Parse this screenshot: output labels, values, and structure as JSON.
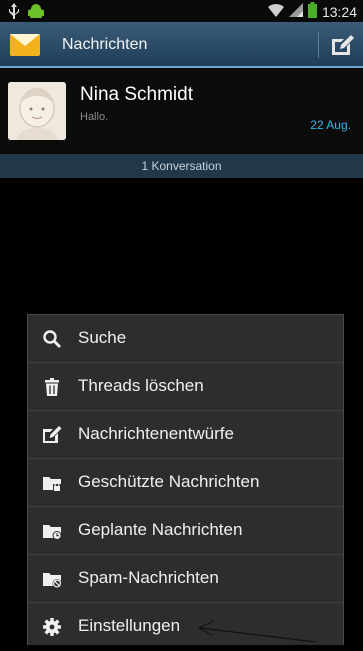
{
  "status_bar": {
    "time": "13:24",
    "icons": [
      "usb-icon",
      "android-icon",
      "wifi-icon",
      "signal-icon",
      "battery-icon"
    ],
    "battery_color": "#4caf2a"
  },
  "action_bar": {
    "title": "Nachrichten",
    "icon": "messages-app-icon",
    "compose_icon": "compose-icon"
  },
  "conversation": {
    "name": "Nina Schmidt",
    "preview": "Hallo.",
    "date": "22 Aug."
  },
  "section": {
    "label": "1 Konversation"
  },
  "menu": {
    "items": [
      {
        "label": "Suche",
        "icon": "search-icon"
      },
      {
        "label": "Threads löschen",
        "icon": "trash-icon"
      },
      {
        "label": "Nachrichtenentwürfe",
        "icon": "drafts-icon"
      },
      {
        "label": "Geschützte Nachrichten",
        "icon": "protected-folder-icon"
      },
      {
        "label": "Geplante Nachrichten",
        "icon": "scheduled-folder-icon"
      },
      {
        "label": "Spam-Nachrichten",
        "icon": "spam-folder-icon"
      },
      {
        "label": "Einstellungen",
        "icon": "gear-icon"
      }
    ]
  },
  "colors": {
    "accent": "#2fb7e6",
    "action_bar": "#2c4a65",
    "section_bar": "#20384a",
    "menu_bg": "#2d2d2d"
  }
}
